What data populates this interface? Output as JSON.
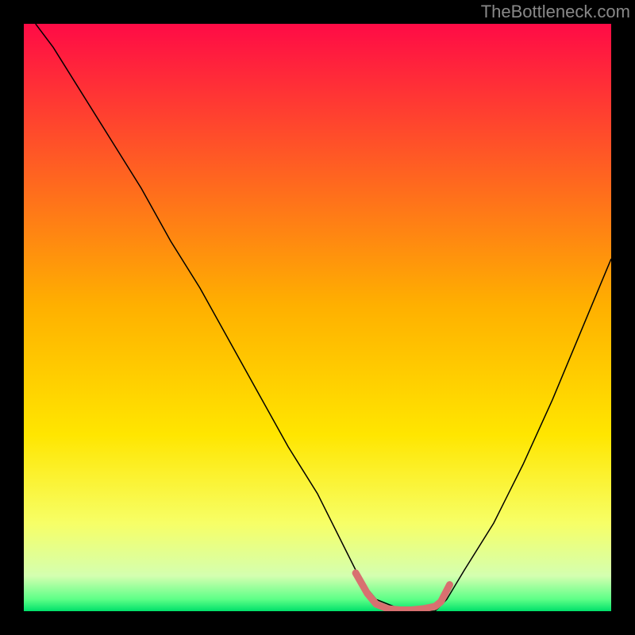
{
  "watermark": "TheBottleneck.com",
  "chart_data": {
    "type": "line",
    "title": "",
    "xlabel": "",
    "ylabel": "",
    "xlim": [
      0,
      100
    ],
    "ylim": [
      0,
      100
    ],
    "grid": false,
    "legend": false,
    "background_gradient": {
      "stops": [
        {
          "offset": 0,
          "color": "#ff0b46"
        },
        {
          "offset": 0.48,
          "color": "#ffb000"
        },
        {
          "offset": 0.7,
          "color": "#ffe600"
        },
        {
          "offset": 0.85,
          "color": "#f7ff66"
        },
        {
          "offset": 0.94,
          "color": "#d4ffb0"
        },
        {
          "offset": 0.98,
          "color": "#5cff87"
        },
        {
          "offset": 1.0,
          "color": "#00e06a"
        }
      ]
    },
    "series": [
      {
        "name": "bottleneck-curve",
        "type": "line",
        "color": "#000000",
        "stroke_width": 1.5,
        "x": [
          2,
          5,
          10,
          15,
          20,
          25,
          30,
          35,
          40,
          45,
          50,
          55,
          57.5,
          60,
          65,
          70,
          72,
          75,
          80,
          85,
          90,
          95,
          100
        ],
        "y": [
          100,
          96,
          88,
          80,
          72,
          63,
          55,
          46,
          37,
          28,
          20,
          10,
          5,
          2,
          0,
          0,
          2,
          7,
          15,
          25,
          36,
          48,
          60
        ]
      },
      {
        "name": "optimal-zone",
        "type": "line",
        "color": "#d87070",
        "stroke_width": 9,
        "linecap": "round",
        "x": [
          56.5,
          58.5,
          60,
          62,
          64,
          66,
          68,
          70,
          71,
          72.5
        ],
        "y": [
          6.5,
          3.0,
          1.2,
          0.4,
          0.2,
          0.2,
          0.4,
          0.8,
          1.6,
          4.5
        ]
      }
    ]
  }
}
